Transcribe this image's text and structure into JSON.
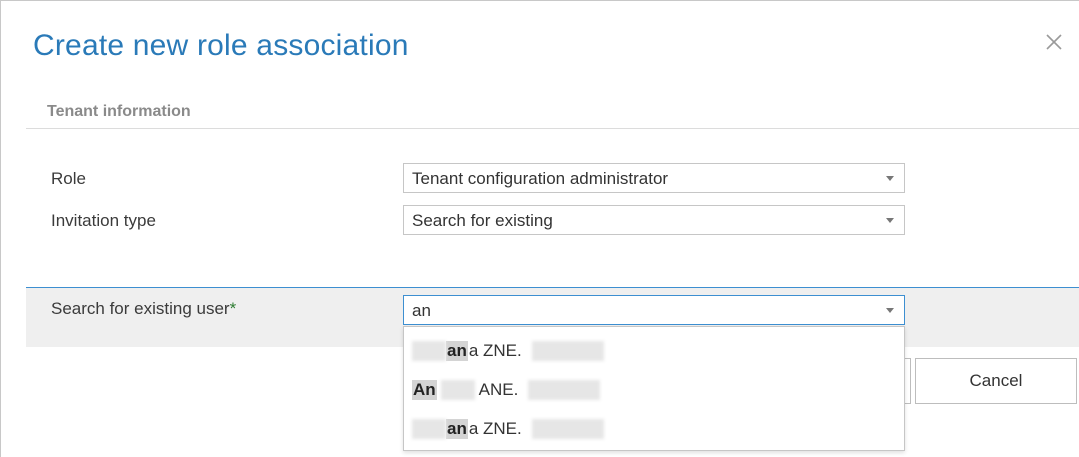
{
  "dialog": {
    "title": "Create new role association",
    "close_icon": "close-icon"
  },
  "section": {
    "title": "Tenant information"
  },
  "fields": {
    "role": {
      "label": "Role",
      "value": "Tenant configuration administrator"
    },
    "invitation_type": {
      "label": "Invitation type",
      "value": "Search for existing"
    },
    "search_user": {
      "label": "Search for existing user",
      "required_marker": "*",
      "value": "an"
    }
  },
  "dropdown": {
    "options": [
      {
        "prefix_blurred": true,
        "match": "an",
        "rest": "a ZNE.",
        "suffix_blurred": true
      },
      {
        "prefix_blurred": false,
        "match": "An",
        "rest": "ANE.",
        "suffix_blurred": true
      },
      {
        "prefix_blurred": true,
        "match": "an",
        "rest": "a ZNE.",
        "suffix_blurred": true
      }
    ]
  },
  "buttons": {
    "cancel": "Cancel"
  },
  "colors": {
    "title": "#2a7ab8",
    "focus_border": "#3d8fd1",
    "required_marker": "#2e7d32",
    "band_background": "#efefef"
  }
}
